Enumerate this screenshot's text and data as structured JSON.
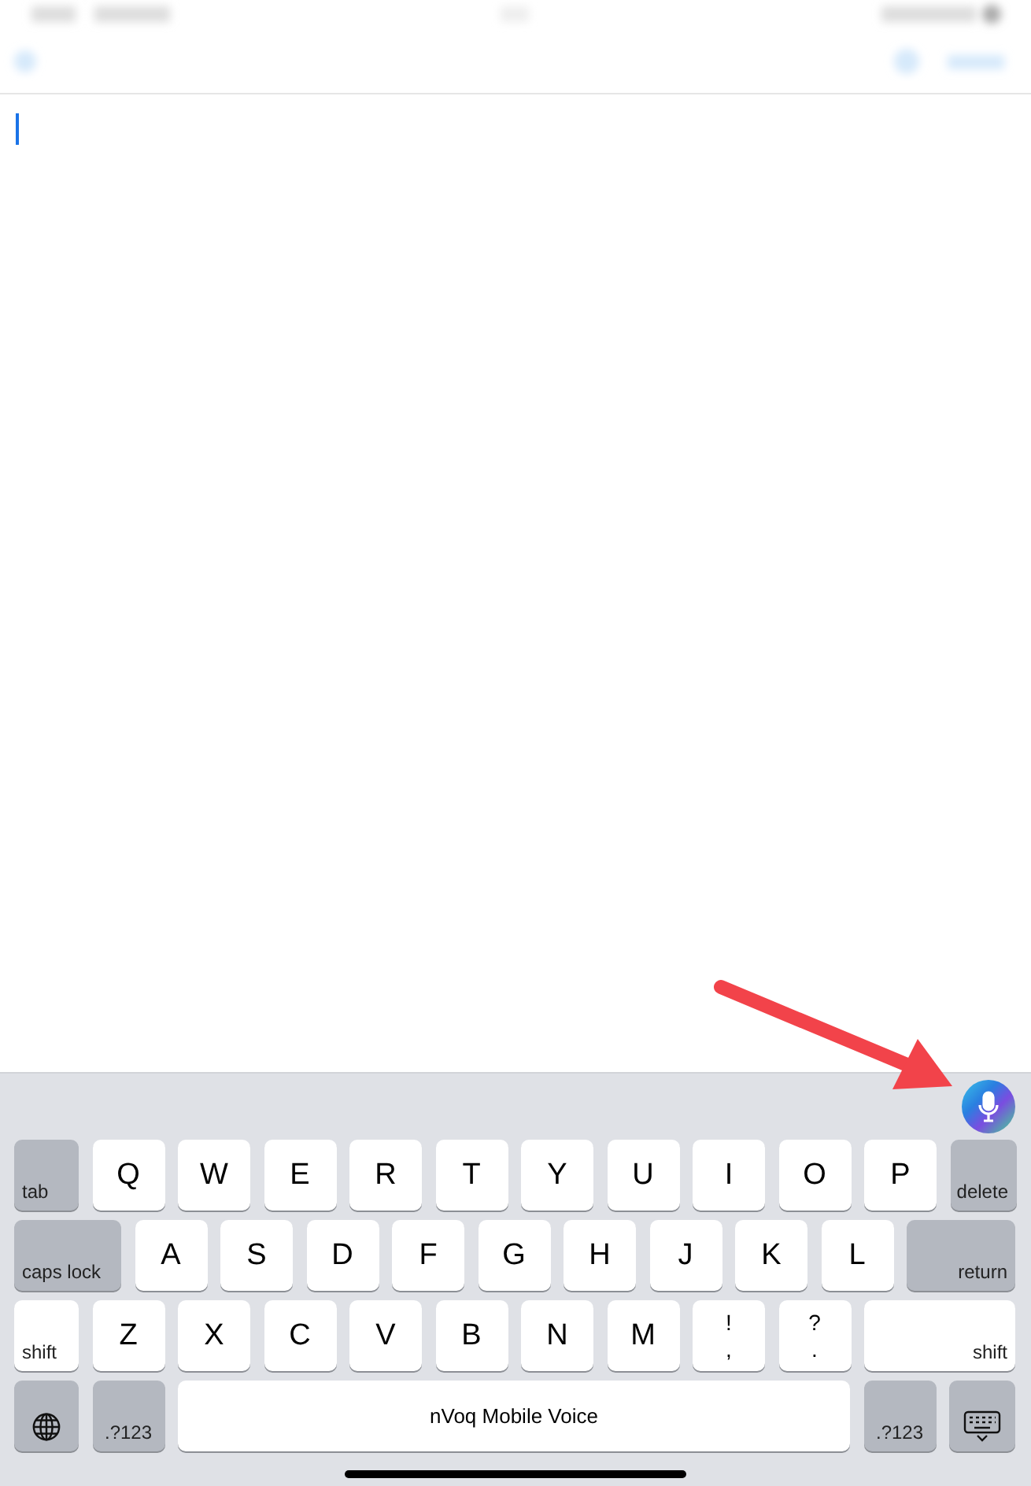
{
  "editor": {
    "cursor": true
  },
  "keyboard": {
    "rows": [
      {
        "keys": [
          {
            "kind": "fn-left",
            "label": "tab"
          },
          {
            "kind": "letter",
            "label": "Q"
          },
          {
            "kind": "letter",
            "label": "W"
          },
          {
            "kind": "letter",
            "label": "E"
          },
          {
            "kind": "letter",
            "label": "R"
          },
          {
            "kind": "letter",
            "label": "T"
          },
          {
            "kind": "letter",
            "label": "Y"
          },
          {
            "kind": "letter",
            "label": "U"
          },
          {
            "kind": "letter",
            "label": "I"
          },
          {
            "kind": "letter",
            "label": "O"
          },
          {
            "kind": "letter",
            "label": "P"
          },
          {
            "kind": "fn-right",
            "label": "delete"
          }
        ]
      },
      {
        "keys": [
          {
            "kind": "fn-left",
            "label": "caps lock"
          },
          {
            "kind": "letter",
            "label": "A"
          },
          {
            "kind": "letter",
            "label": "S"
          },
          {
            "kind": "letter",
            "label": "D"
          },
          {
            "kind": "letter",
            "label": "F"
          },
          {
            "kind": "letter",
            "label": "G"
          },
          {
            "kind": "letter",
            "label": "H"
          },
          {
            "kind": "letter",
            "label": "J"
          },
          {
            "kind": "letter",
            "label": "K"
          },
          {
            "kind": "letter",
            "label": "L"
          },
          {
            "kind": "fn-right",
            "label": "return"
          }
        ]
      },
      {
        "keys": [
          {
            "kind": "shift-left",
            "label": "shift"
          },
          {
            "kind": "letter",
            "label": "Z"
          },
          {
            "kind": "letter",
            "label": "X"
          },
          {
            "kind": "letter",
            "label": "C"
          },
          {
            "kind": "letter",
            "label": "V"
          },
          {
            "kind": "letter",
            "label": "B"
          },
          {
            "kind": "letter",
            "label": "N"
          },
          {
            "kind": "letter",
            "label": "M"
          },
          {
            "kind": "symbol",
            "label": "!",
            "sub": ","
          },
          {
            "kind": "symbol",
            "label": "?",
            "sub": "."
          },
          {
            "kind": "shift-right",
            "label": "shift"
          }
        ]
      },
      {
        "keys": [
          {
            "kind": "globe"
          },
          {
            "kind": "fn-center",
            "label": ".?123"
          },
          {
            "kind": "space",
            "label": "nVoq Mobile Voice"
          },
          {
            "kind": "fn-center",
            "label": ".?123"
          },
          {
            "kind": "hide"
          }
        ]
      }
    ]
  }
}
